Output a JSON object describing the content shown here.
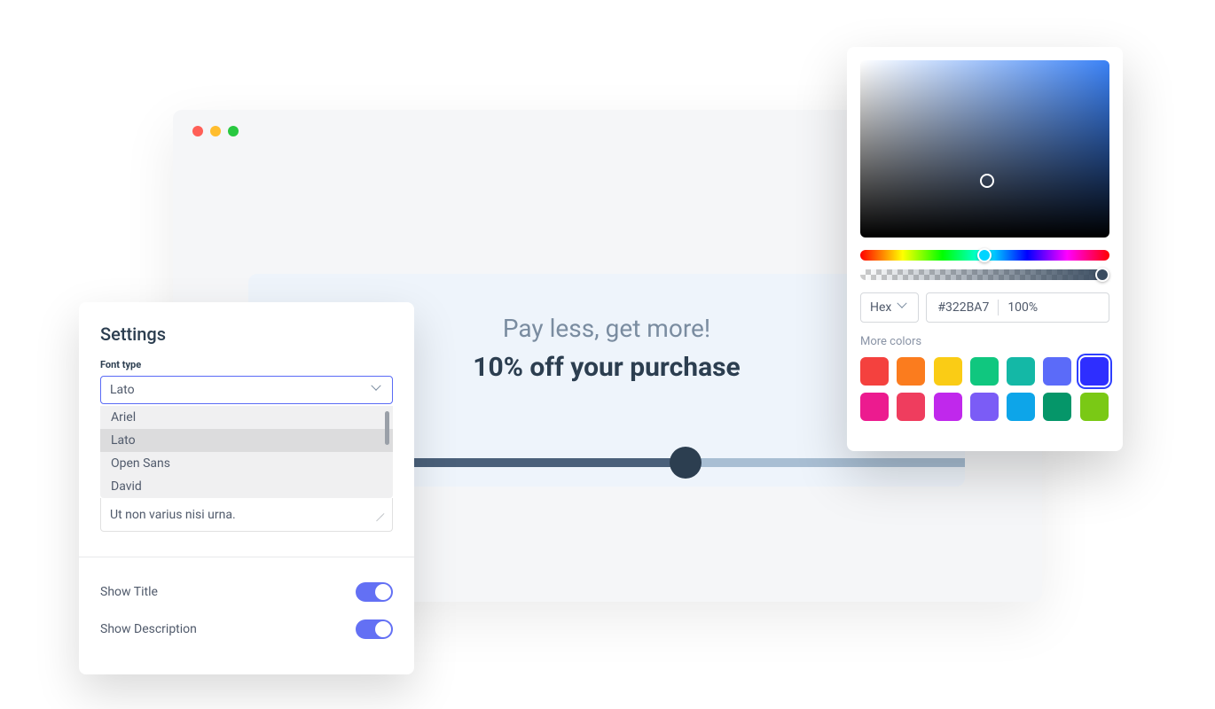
{
  "browser": {
    "banner": {
      "title": "Pay less, get more!",
      "subtitle": "10% off your purchase"
    }
  },
  "settings": {
    "title": "Settings",
    "font_type_label": "Font type",
    "selected_font": "Lato",
    "font_options": [
      "Ariel",
      "Lato",
      "Open Sans",
      "David"
    ],
    "textarea_value": "Ut non varius nisi urna.",
    "toggles": {
      "show_title_label": "Show Title",
      "show_description_label": "Show Description"
    }
  },
  "color_picker": {
    "format_label": "Hex",
    "hex_value": "#322BA7",
    "opacity_value": "100%",
    "more_colors_label": "More colors",
    "swatches": [
      "#f4413e",
      "#fb7c1e",
      "#facc15",
      "#10c77f",
      "#14b8a6",
      "#5b6bf9",
      "#2e2eff",
      "#ec1b8f",
      "#ef3d5e",
      "#c028ec",
      "#7b5cf6",
      "#0da5e9",
      "#059669",
      "#7ac915"
    ],
    "selected_swatch_index": 6
  }
}
